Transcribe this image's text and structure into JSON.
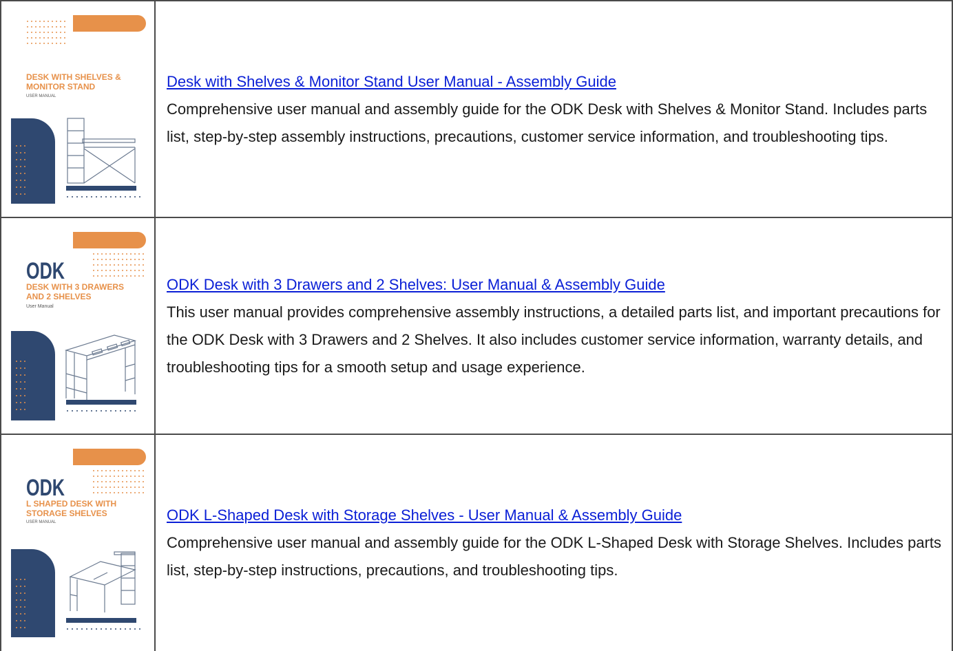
{
  "colors": {
    "orange": "#E7914A",
    "navy": "#2F4870",
    "link": "#0A1FD6",
    "border": "#4A4A4A"
  },
  "items": [
    {
      "cover": {
        "brand": "",
        "title_line1": "DESK WITH SHELVES &",
        "title_line2": "MONITOR STAND",
        "subtitle": "USER MANUAL",
        "illustration": "desk-with-hutch-icon"
      },
      "title": "Desk with Shelves & Monitor Stand User Manual - Assembly Guide",
      "description": "Comprehensive user manual and assembly guide for the ODK Desk with Shelves & Monitor Stand. Includes parts list, step-by-step assembly instructions, precautions, customer service information, and troubleshooting tips."
    },
    {
      "cover": {
        "brand": "ODK",
        "title_line1": "DESK WITH 3 DRAWERS",
        "title_line2": "AND 2 SHELVES",
        "subtitle": "User Manual",
        "illustration": "desk-with-drawers-icon"
      },
      "title": "ODK Desk with 3 Drawers and 2 Shelves: User Manual & Assembly Guide",
      "description": "This user manual provides comprehensive assembly instructions, a detailed parts list, and important precautions for the ODK Desk with 3 Drawers and 2 Shelves. It also includes customer service information, warranty details, and troubleshooting tips for a smooth setup and usage experience."
    },
    {
      "cover": {
        "brand": "ODK",
        "title_line1": "L SHAPED DESK WITH",
        "title_line2": "STORAGE SHELVES",
        "subtitle": "USER MANUAL",
        "illustration": "l-shaped-desk-icon"
      },
      "title": "ODK L-Shaped Desk with Storage Shelves - User Manual & Assembly Guide",
      "description": "Comprehensive user manual and assembly guide for the ODK L-Shaped Desk with Storage Shelves. Includes parts list, step-by-step instructions, precautions, and troubleshooting tips."
    }
  ]
}
